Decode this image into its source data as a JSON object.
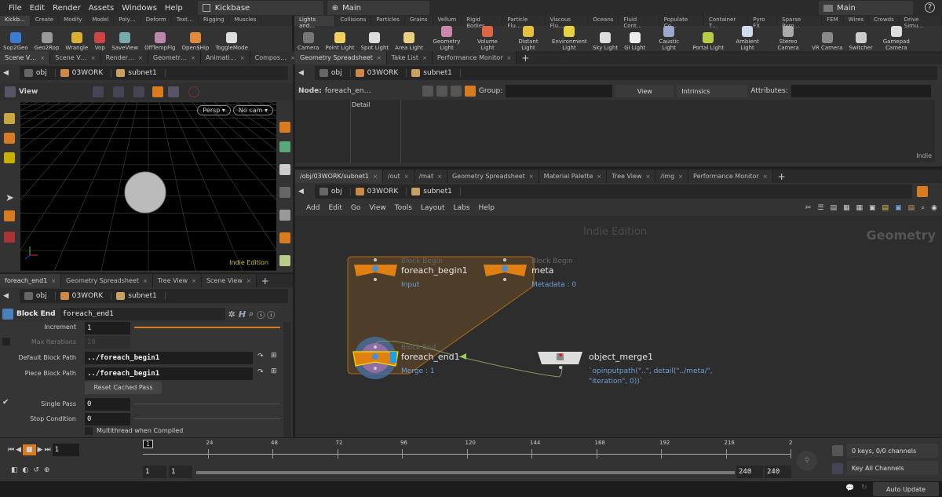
{
  "menubar": {
    "items": [
      "File",
      "Edit",
      "Render",
      "Assets",
      "Windows",
      "Help"
    ],
    "desktop": "Kickbase",
    "context": "Main",
    "right_context": "Main"
  },
  "shelf_left": {
    "tabs": [
      "Kickb…",
      "Create",
      "Modify",
      "Model",
      "Poly…",
      "Deform",
      "Text…",
      "Rigging",
      "Muscles"
    ],
    "tools": [
      {
        "label": "Sop2Geo",
        "color": "#3a7bd5"
      },
      {
        "label": "Geo2Rop",
        "color": "#999"
      },
      {
        "label": "Wrangle",
        "color": "#d9b030"
      },
      {
        "label": "Vop",
        "color": "#c44"
      },
      {
        "label": "SaveView",
        "color": "#7aa"
      },
      {
        "label": "OffTempFlg",
        "color": "#b8a"
      },
      {
        "label": "Open$Hip",
        "color": "#e08a3a"
      },
      {
        "label": "ToggleMode",
        "color": "#ddd"
      }
    ]
  },
  "shelf_right": {
    "tabs": [
      "Lights and…",
      "Collisions",
      "Particles",
      "Grains",
      "Vellum",
      "Rigid Bodies",
      "Particle Flu…",
      "Viscous Flu…",
      "Oceans",
      "Fluid Cont…",
      "Populate Co…",
      "Container T…",
      "Pyro FX",
      "Sparse Pyro…",
      "FEM",
      "Wires",
      "Crowds",
      "Drive Simu…"
    ],
    "tools": [
      {
        "label": "Camera",
        "color": "#777"
      },
      {
        "label": "Point Light",
        "color": "#f0d060"
      },
      {
        "label": "Spot Light",
        "color": "#ddd"
      },
      {
        "label": "Area Light",
        "color": "#e8d080"
      },
      {
        "label": "Geometry Light",
        "color": "#c8a"
      },
      {
        "label": "Volume Light",
        "color": "#d64"
      },
      {
        "label": "Distant Light",
        "color": "#e8c040"
      },
      {
        "label": "Environment Light",
        "color": "#e8d040"
      },
      {
        "label": "Sky Light",
        "color": "#ddd"
      },
      {
        "label": "GI Light",
        "color": "#eee"
      },
      {
        "label": "Caustic Light",
        "color": "#9ac"
      },
      {
        "label": "Portal Light",
        "color": "#bc4"
      },
      {
        "label": "Ambient Light",
        "color": "#cde"
      },
      {
        "label": "Stereo Camera",
        "color": "#aaa"
      },
      {
        "label": "VR Camera",
        "color": "#888"
      },
      {
        "label": "Switcher",
        "color": "#ccc"
      },
      {
        "label": "Gamepad Camera",
        "color": "#ddd"
      }
    ]
  },
  "scene_pane": {
    "tabs": [
      "Scene V…",
      "Scene V…",
      "Render…",
      "Geometr…",
      "Animati…",
      "Compos…"
    ],
    "path": [
      "obj",
      "03WORK",
      "subnet1"
    ],
    "toolbar_title": "View",
    "persp": "Persp",
    "cam": "No cam",
    "watermark": "Indie Edition",
    "axes": [
      "x",
      "y",
      "z"
    ]
  },
  "params_pane": {
    "tabs": [
      "foreach_end1",
      "Geometry Spreadsheet",
      "Tree View",
      "Scene View"
    ],
    "path": [
      "obj",
      "03WORK",
      "subnet1"
    ],
    "node_type": "Block End",
    "node_name": "foreach_end1",
    "params": {
      "increment_label": "Increment",
      "increment": "1",
      "max_iter_label": "Max Iterations",
      "max_iter": "10",
      "default_path_label": "Default Block Path",
      "default_path": "../foreach_begin1",
      "piece_path_label": "Piece Block Path",
      "piece_path": "../foreach_begin1",
      "reset_button": "Reset Cached Pass",
      "single_pass_label": "Single Pass",
      "single_pass": "0",
      "single_pass_checked": true,
      "stop_label": "Stop Condition",
      "stop": "0",
      "multithread_label": "Multithread when Compiled",
      "multithread_checked": false
    }
  },
  "spreadsheet_pane": {
    "tabs": [
      "Geometry Spreadsheet",
      "Take List",
      "Performance Monitor"
    ],
    "path": [
      "obj",
      "03WORK",
      "subnet1"
    ],
    "node_label": "Node:",
    "node_value": "foreach_en…",
    "group_label": "Group:",
    "view": "View",
    "intrinsics": "Intrinsics",
    "attributes_label": "Attributes:",
    "column": "Detail",
    "watermark": "Indie"
  },
  "network_pane": {
    "tabs": [
      "/obj/03WORK/subnet1",
      "/out",
      "/mat",
      "Geometry Spreadsheet",
      "Material Palette",
      "Tree View",
      "/img",
      "Performance Monitor"
    ],
    "path": [
      "obj",
      "03WORK",
      "subnet1"
    ],
    "menu": [
      "Add",
      "Edit",
      "Go",
      "View",
      "Tools",
      "Layout",
      "Labs",
      "Help"
    ],
    "watermark": "Indie Edition",
    "context": "Geometry",
    "nodes": [
      {
        "type": "Block Begin",
        "name": "foreach_begin1",
        "sub": "Input"
      },
      {
        "type": "Block Begin",
        "name": "meta",
        "sub": "Metadata : 0"
      },
      {
        "type": "Block End",
        "name": "foreach_end1",
        "sub": "Merge : 1"
      },
      {
        "type": "",
        "name": "object_merge1",
        "sub": "`opinputpath(\"..\", detail(\"../meta/\",",
        "sub2": "\"iteration\", 0))`"
      }
    ]
  },
  "timeline": {
    "frame": "1",
    "ticks": [
      "24",
      "48",
      "72",
      "96",
      "120",
      "144",
      "168",
      "192",
      "216",
      "2"
    ],
    "current_marker": "1",
    "range_start": "1",
    "range_start2": "1",
    "range_end": "240",
    "range_end2": "240",
    "keys": "0 keys, 0/0 channels",
    "key_all": "Key All Channels",
    "auto_update": "Auto Update"
  },
  "colors": {
    "accent": "#d87a1e",
    "node_blue": "#6f9fd6",
    "bg": "#333333"
  }
}
